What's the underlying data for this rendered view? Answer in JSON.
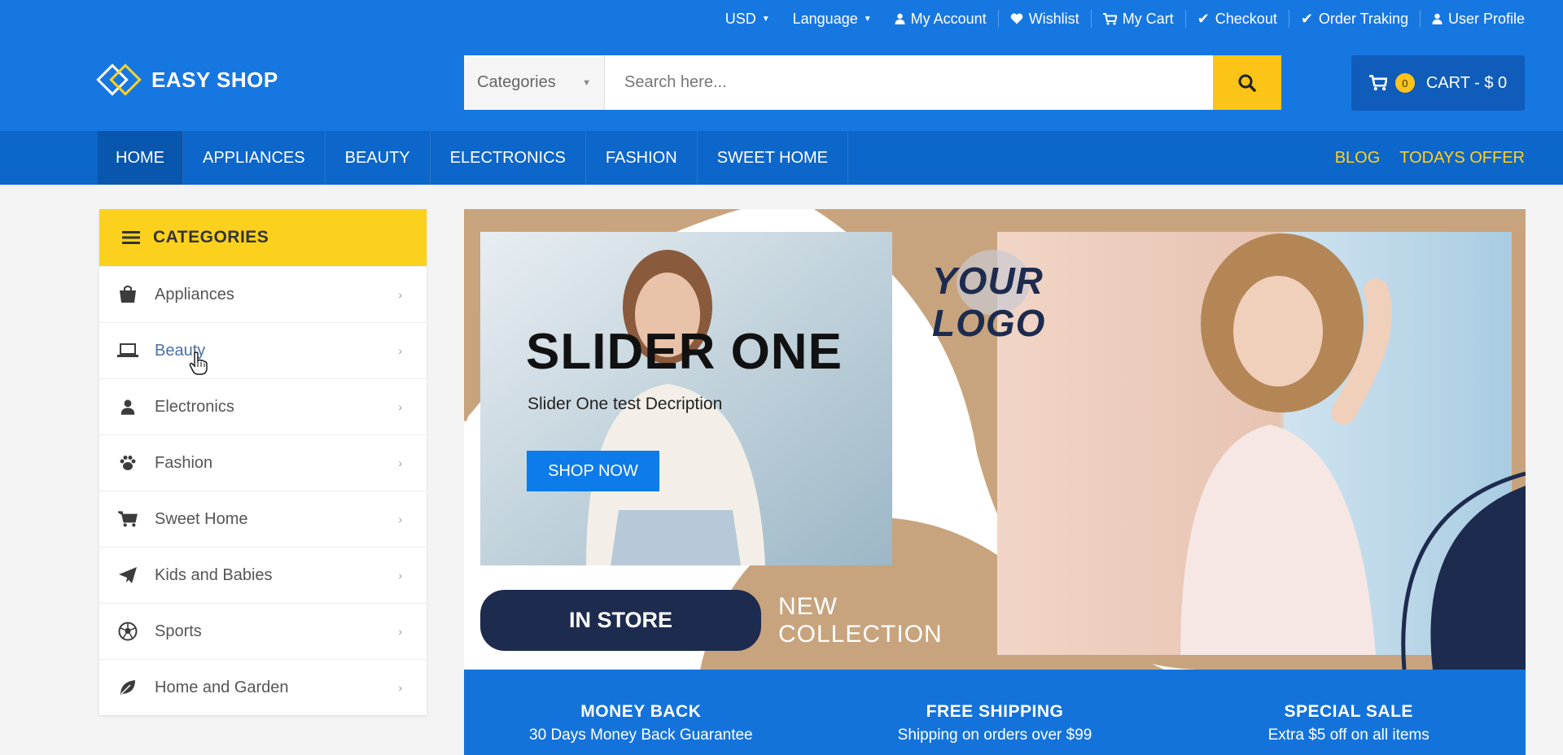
{
  "topbar": {
    "currency": "USD",
    "language": "Language",
    "links": [
      {
        "label": "My Account",
        "icon": "user-icon"
      },
      {
        "label": "Wishlist",
        "icon": "heart-icon"
      },
      {
        "label": "My Cart",
        "icon": "cart-icon"
      },
      {
        "label": "Checkout",
        "icon": "check-icon"
      },
      {
        "label": "Order Traking",
        "icon": "check-icon"
      },
      {
        "label": "User Profile",
        "icon": "user-icon"
      }
    ]
  },
  "header": {
    "logo_text": "EASY SHOP",
    "search": {
      "category": "Categories",
      "placeholder": "Search here..."
    },
    "cart": {
      "count": "0",
      "label": "CART - $ 0"
    }
  },
  "nav": {
    "items": [
      "HOME",
      "APPLIANCES",
      "BEAUTY",
      "ELECTRONICS",
      "FASHION",
      "SWEET HOME"
    ],
    "right": [
      "BLOG",
      "TODAYS OFFER"
    ]
  },
  "sidebar": {
    "title": "CATEGORIES",
    "items": [
      {
        "label": "Appliances",
        "icon": "shopping-bag-icon"
      },
      {
        "label": "Beauty",
        "icon": "laptop-icon"
      },
      {
        "label": "Electronics",
        "icon": "user-icon"
      },
      {
        "label": "Fashion",
        "icon": "paw-icon"
      },
      {
        "label": "Sweet Home",
        "icon": "cart-icon"
      },
      {
        "label": "Kids and Babies",
        "icon": "paper-plane-icon"
      },
      {
        "label": "Sports",
        "icon": "soccer-ball-icon"
      },
      {
        "label": "Home and Garden",
        "icon": "leaf-icon"
      }
    ]
  },
  "slider": {
    "title": "SLIDER ONE",
    "description": "Slider One test Decription",
    "button": "SHOP NOW",
    "logo_text": [
      "YOUR",
      "LOGO"
    ],
    "in_store": "IN STORE",
    "new_collection": [
      "NEW",
      "COLLECTION"
    ]
  },
  "features": [
    {
      "title": "MONEY BACK",
      "subtitle": "30 Days Money Back Guarantee"
    },
    {
      "title": "FREE SHIPPING",
      "subtitle": "Shipping on orders over $99"
    },
    {
      "title": "SPECIAL SALE",
      "subtitle": "Extra $5 off on all items"
    }
  ],
  "colors": {
    "primary": "#1777e0",
    "nav": "#0d66c9",
    "accent": "#fcd11e",
    "dark_navy": "#1d2b4e",
    "tan": "#c8a47e"
  }
}
